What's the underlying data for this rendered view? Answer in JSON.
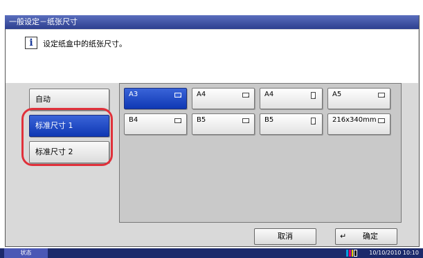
{
  "title": "一般设定－纸张尺寸",
  "message": "设定纸盒中的纸张尺寸。",
  "sidebar": {
    "items": [
      {
        "label": "自动",
        "selected": false
      },
      {
        "label": "标准尺寸 1",
        "selected": true
      },
      {
        "label": "标准尺寸 2",
        "selected": false
      }
    ]
  },
  "paper_sizes": [
    {
      "label": "A3",
      "orientation": "landscape",
      "selected": true
    },
    {
      "label": "A4",
      "orientation": "landscape",
      "selected": false
    },
    {
      "label": "A4",
      "orientation": "portrait",
      "selected": false
    },
    {
      "label": "A5",
      "orientation": "landscape",
      "selected": false
    },
    {
      "label": "B4",
      "orientation": "landscape",
      "selected": false
    },
    {
      "label": "B5",
      "orientation": "landscape",
      "selected": false
    },
    {
      "label": "B5",
      "orientation": "portrait",
      "selected": false
    },
    {
      "label": "216x340mm",
      "orientation": "landscape",
      "selected": false
    }
  ],
  "actions": {
    "cancel_label": "取消",
    "ok_label": "确定",
    "ok_icon": "enter-arrow-icon"
  },
  "status_bar": {
    "status_label": "状态",
    "datetime": "10/10/2010  10:10",
    "toner_colors": [
      "#00a0e0",
      "#e0007a",
      "#f0d000",
      "#111111"
    ]
  },
  "colors": {
    "selected": "#1540c0",
    "title_bar": "#3d4fa5",
    "highlight_ring": "#e0303a"
  }
}
